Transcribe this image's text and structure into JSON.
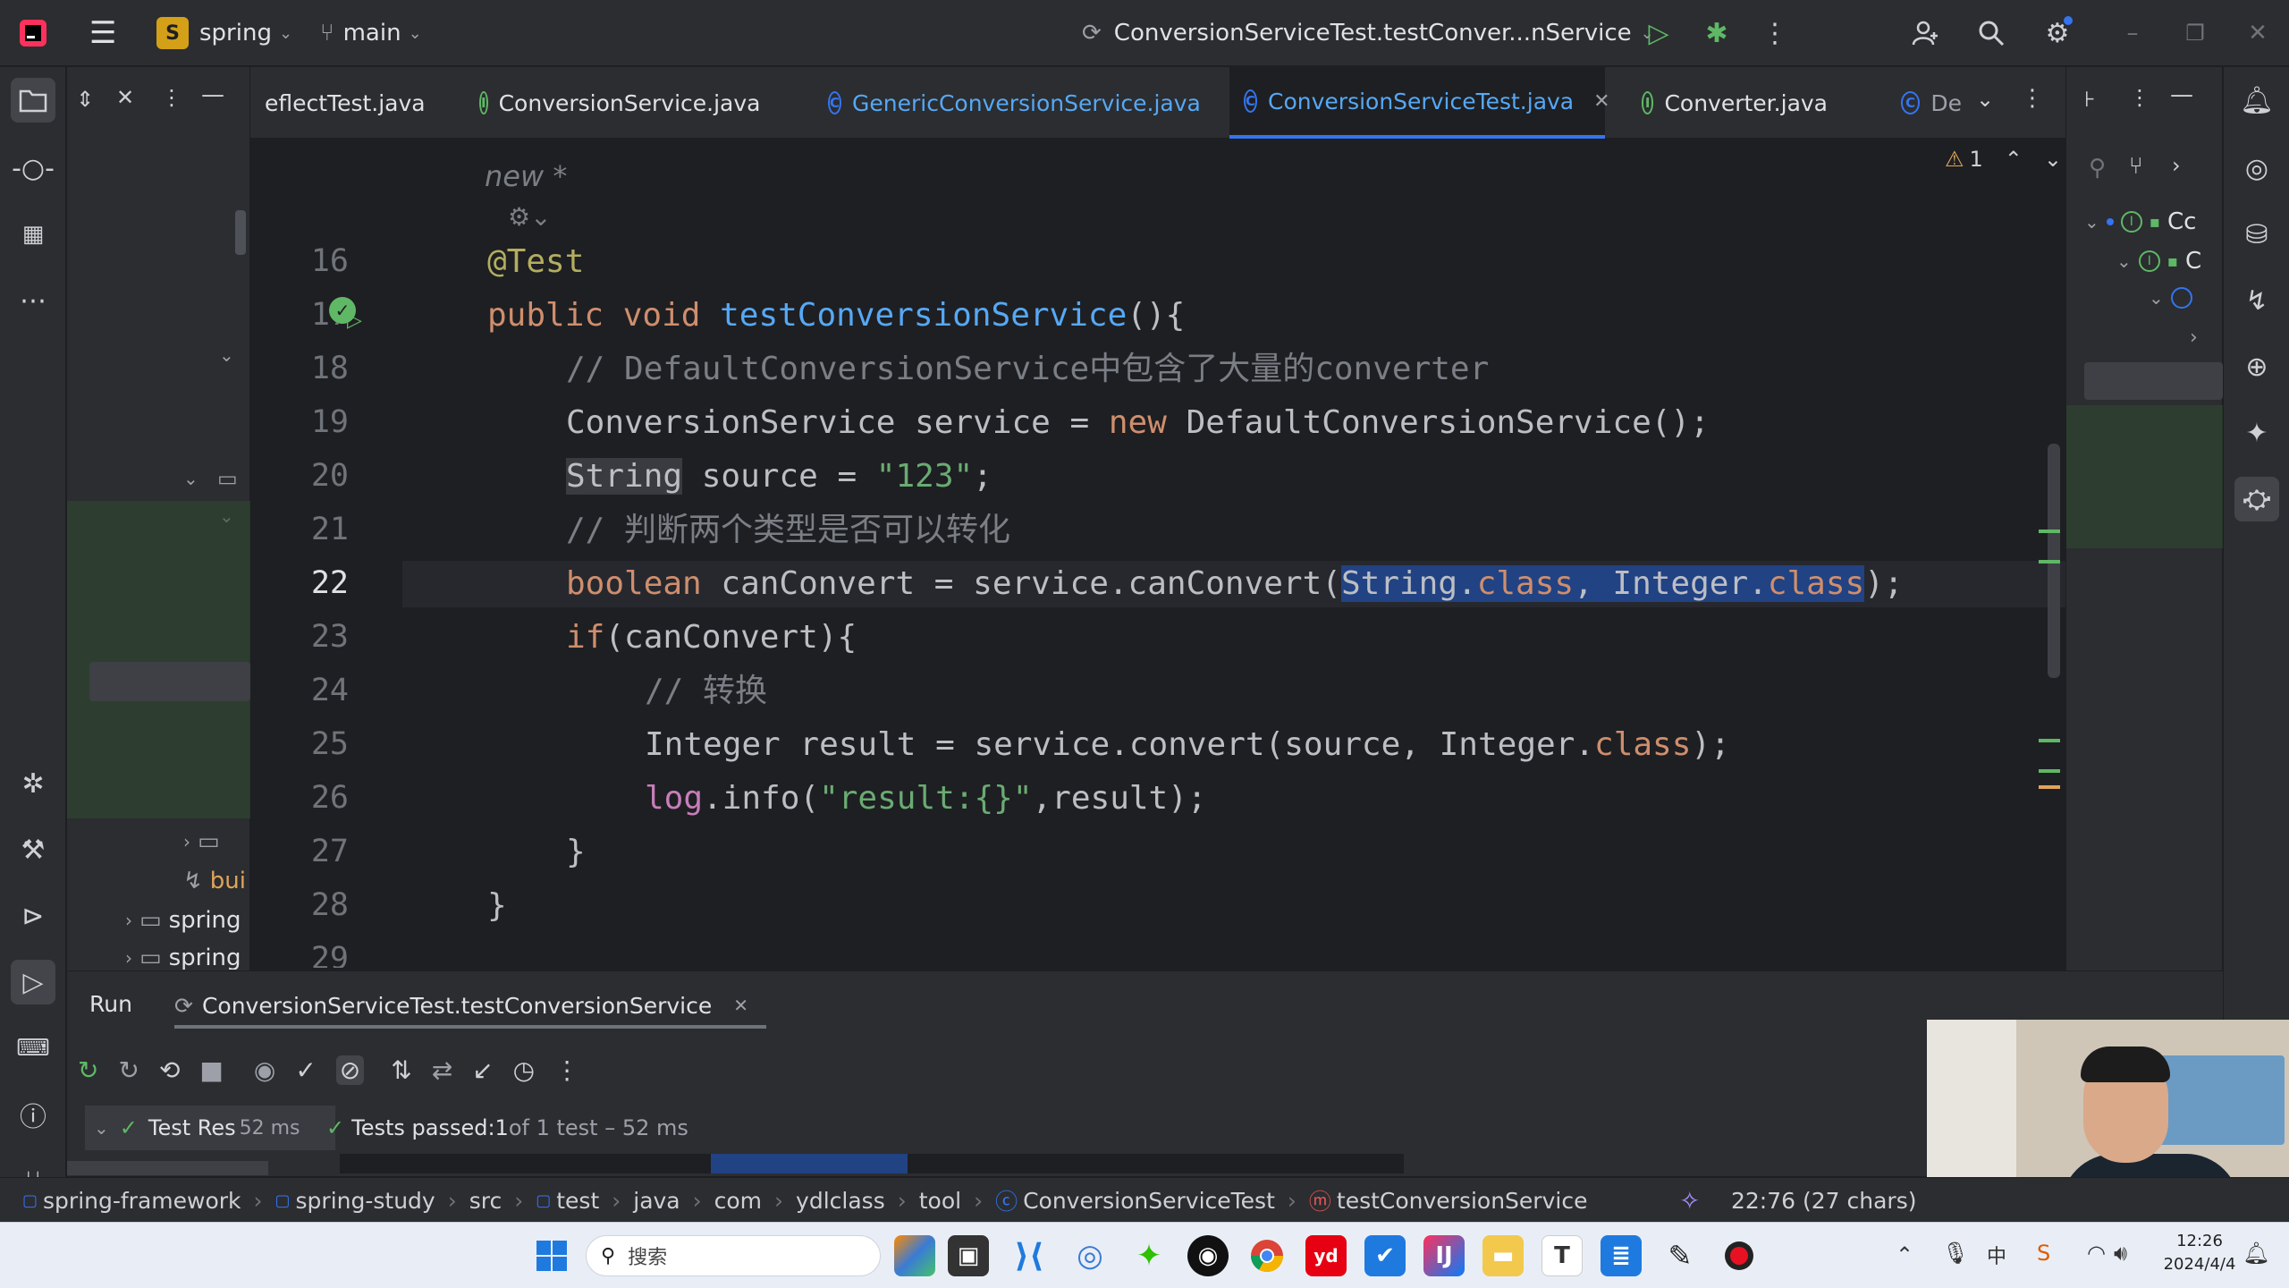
{
  "titlebar": {
    "project_badge": "S",
    "project_name": "spring",
    "branch": "main",
    "run_config": "ConversionServiceTest.testConver...nService"
  },
  "tabs": [
    {
      "label": "eflectTest.java",
      "icon": "",
      "color": "#dfe1e5"
    },
    {
      "label": "ConversionService.java",
      "icon": "I",
      "color": "#dfe1e5"
    },
    {
      "label": "GenericConversionService.java",
      "icon": "C",
      "color": "#56a8f5"
    },
    {
      "label": "ConversionServiceTest.java",
      "icon": "C",
      "color": "#56a8f5"
    },
    {
      "label": "Converter.java",
      "icon": "I",
      "color": "#dfe1e5"
    },
    {
      "label": "De",
      "icon": "C",
      "color": "#dfe1e5"
    }
  ],
  "editor": {
    "inlay_hint": "new *",
    "warnings_count": "1",
    "line_numbers": [
      "16",
      "17",
      "18",
      "19",
      "20",
      "21",
      "22",
      "23",
      "24",
      "25",
      "26",
      "27",
      "28",
      "29"
    ],
    "lines": {
      "l16": "@Test",
      "l17_kw": "public void ",
      "l17_fn": "testConversionService",
      "l17_rest": "(){",
      "l18": "// DefaultConversionService中包含了大量的converter",
      "l19_a": "ConversionService service = ",
      "l19_kw": "new",
      "l19_b": " DefaultConversionService();",
      "l20_a": "String",
      "l20_b": " source = ",
      "l20_str": "\"123\"",
      "l20_c": ";",
      "l21": "// 判断两个类型是否可以转化",
      "l22_kw": "boolean",
      "l22_a": " canConvert = service.canConvert(",
      "l22_sel1": "String.",
      "l22_sel_kw1": "class",
      "l22_sel2": ", Integer.",
      "l22_sel_kw2": "class",
      "l22_b": ");",
      "l23_kw": "if",
      "l23_a": "(canConvert){",
      "l24": "// 转换",
      "l25_a": "Integer result = service.convert(source, Integer.",
      "l25_kw": "class",
      "l25_b": ");",
      "l26_fld": "log",
      "l26_a": ".info(",
      "l26_str": "\"result:{}\"",
      "l26_b": ",result);",
      "l27": "}",
      "l28": "}"
    }
  },
  "project_panel": {
    "items": [
      "bui",
      "spring",
      "spring"
    ]
  },
  "structure_panel": {
    "items": [
      "Cc",
      "C"
    ]
  },
  "run_panel": {
    "tab_run": "Run",
    "tab_config": "ConversionServiceTest.testConversionService",
    "tree_item": "Test Res",
    "tree_time": "52 ms",
    "result_prefix": "Tests passed: ",
    "result_count": "1",
    "result_suffix": " of 1 test – 52 ms"
  },
  "statusbar": {
    "breadcrumbs": [
      "spring-framework",
      "spring-study",
      "src",
      "test",
      "java",
      "com",
      "ydlclass",
      "tool",
      "ConversionServiceTest",
      "testConversionService"
    ],
    "position": "22:76 (27 chars)"
  },
  "taskbar": {
    "search_placeholder": "搜索",
    "time": "12:26",
    "date": "2024/4/4",
    "ime": "中"
  }
}
